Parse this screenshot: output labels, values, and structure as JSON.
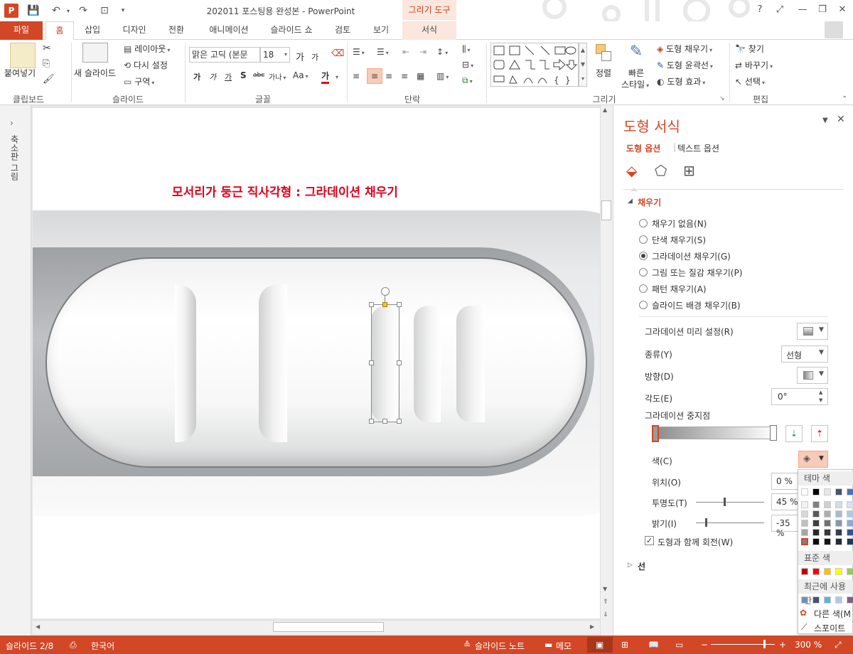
{
  "window": {
    "title": "202011 포스팅용 완성본 - PowerPoint",
    "context_tab_group": "그리기 도구",
    "help": "?",
    "minimize": "—",
    "restore": "❐",
    "close": "✕"
  },
  "tabs": [
    "파일",
    "홈",
    "삽입",
    "디자인",
    "전환",
    "애니메이션",
    "슬라이드 쇼",
    "검토",
    "보기",
    "서식"
  ],
  "ribbon": {
    "clipboard": {
      "paste": "붙여넣기",
      "label": "클립보드"
    },
    "slides": {
      "new_slide": "새 슬라이드",
      "layout": "레이아웃",
      "reset": "다시 설정",
      "section": "구역",
      "label": "슬라이드"
    },
    "font": {
      "font_name": "맑은 고딕 (본문",
      "font_size": "18",
      "bold": "가",
      "italic": "가",
      "underline": "가",
      "shadow": "S",
      "strike": "abc",
      "spacing": "가나",
      "case": "Aa",
      "color": "가",
      "grow": "가",
      "shrink": "가",
      "label": "글꼴"
    },
    "paragraph": {
      "label": "단락"
    },
    "drawing": {
      "arrange": "정렬",
      "quick_styles_1": "빠른",
      "quick_styles_2": "스타일",
      "shape_fill": "도형 채우기",
      "shape_outline": "도형 윤곽선",
      "shape_effects": "도형 효과",
      "label": "그리기"
    },
    "editing": {
      "find": "찾기",
      "replace": "바꾸기",
      "select": "선택",
      "label": "편집"
    }
  },
  "thumbnail_pane": {
    "label": "축소판 그림"
  },
  "slide": {
    "title": "모서리가 둥근 직사각형 : 그라데이션 채우기"
  },
  "format_pane": {
    "title": "도형 서식",
    "tab_shape": "도형 옵션",
    "tab_text": "텍스트 옵션",
    "fill_section": "채우기",
    "fill_options": [
      {
        "label": "채우기 없음(N)",
        "selected": false
      },
      {
        "label": "단색 채우기(S)",
        "selected": false
      },
      {
        "label": "그라데이션 채우기(G)",
        "selected": true
      },
      {
        "label": "그림 또는 질감 채우기(P)",
        "selected": false
      },
      {
        "label": "패턴 채우기(A)",
        "selected": false
      },
      {
        "label": "슬라이드 배경 채우기(B)",
        "selected": false
      }
    ],
    "preset_label": "그라데이션 미리 설정(R)",
    "type_label": "종류(Y)",
    "type_value": "선형",
    "direction_label": "방향(D)",
    "angle_label": "각도(E)",
    "angle_value": "0°",
    "stops_label": "그라데이션 중지점",
    "color_label": "색(C)",
    "position_label": "위치(O)",
    "position_value": "0 %",
    "transparency_label": "투명도(T)",
    "transparency_value": "45 %",
    "transparency_level": 45,
    "brightness_label": "밝기(I)",
    "brightness_value": "-35 %",
    "brightness_level": -35,
    "rotate_label": "도형과 함께 회전(W)",
    "rotate_checked": true,
    "line_section": "선"
  },
  "color_picker": {
    "theme_label": "테마 색",
    "standard_label": "표준 색",
    "recent_label": "최근에 사용한",
    "more_colors": "다른 색(M",
    "eyedropper": "스포이트",
    "theme_top": [
      "#ffffff",
      "#000000",
      "#e7e6e6",
      "#44546a",
      "#4472c4"
    ],
    "theme_shades": [
      [
        "#f2f2f2",
        "#7f7f7f",
        "#d0cece",
        "#d6dce4",
        "#d9e2f3"
      ],
      [
        "#d9d9d9",
        "#595959",
        "#aeabab",
        "#adb9ca",
        "#b4c6e7"
      ],
      [
        "#bfbfbf",
        "#3f3f3f",
        "#757070",
        "#8496b0",
        "#8eaadb"
      ],
      [
        "#a6a6a6",
        "#262626",
        "#3a3838",
        "#333f4f",
        "#2f5496"
      ],
      [
        "#7f7f7f",
        "#0d0d0d",
        "#171616",
        "#222a35",
        "#1f3864"
      ]
    ],
    "standard": [
      "#c00000",
      "#ff0000",
      "#ffc000",
      "#ffff00",
      "#92d050"
    ],
    "recent": [
      "#6d8fc0",
      "#44546a",
      "#5bb4e0",
      "#b4c7e7",
      "#7f6084"
    ]
  },
  "statusbar": {
    "slide": "슬라이드 2/8",
    "language": "한국어",
    "notes": "슬라이드 노트",
    "comments": "메모",
    "zoom": "300 %",
    "zoom_minus": "−",
    "zoom_plus": "+"
  }
}
